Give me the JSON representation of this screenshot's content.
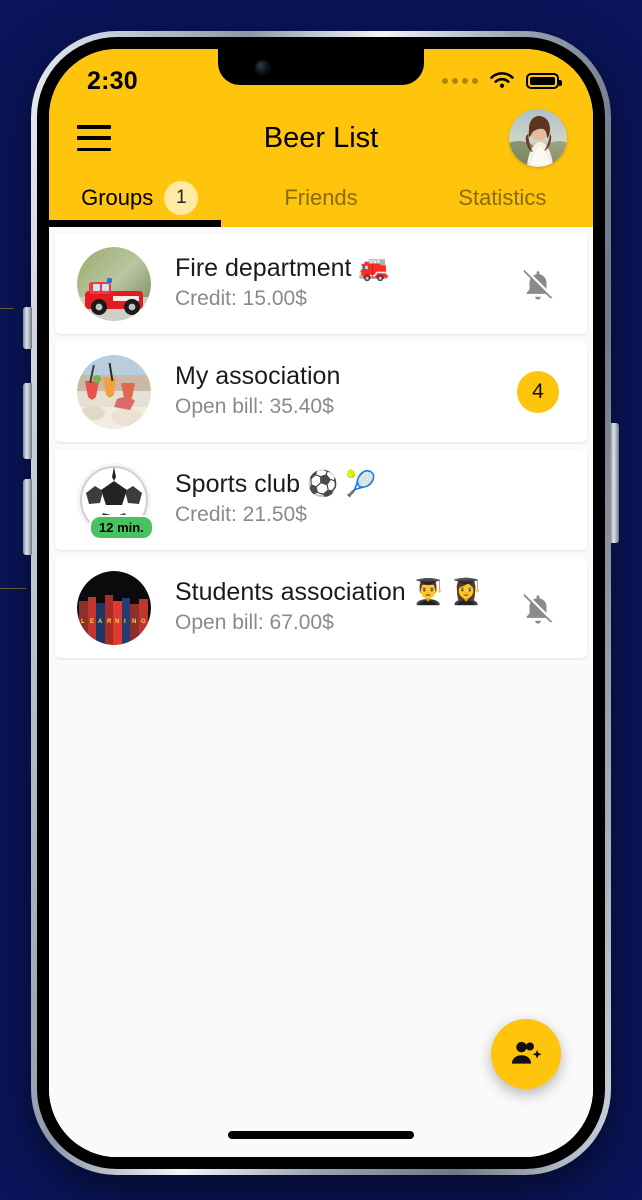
{
  "theme": {
    "backdrop_color": "#0a1559",
    "accent_color": "#FFC40C",
    "badge_soft_color": "#FFE9A3",
    "screen_bg": "#fafafa",
    "card_bg": "#ffffff",
    "muted_text": "#8a8a8a",
    "online_badge_color": "#48c261"
  },
  "status_bar": {
    "time": "2:30",
    "signal_icon": "signal-dots-icon",
    "wifi_icon": "wifi-icon",
    "battery_icon": "battery-full-icon"
  },
  "nav": {
    "menu_icon": "hamburger-menu-icon",
    "title": "Beer List",
    "avatar_icon": "user-avatar-photo"
  },
  "tabs": [
    {
      "label": "Groups",
      "badge": "1",
      "active": true
    },
    {
      "label": "Friends",
      "badge": null,
      "active": false
    },
    {
      "label": "Statistics",
      "badge": null,
      "active": false
    }
  ],
  "groups": [
    {
      "name": "Fire department 🚒",
      "subtitle": "Credit: 15.00$",
      "avatar_icon": "fire-truck-photo",
      "time_badge": null,
      "trailing_type": "bell-off",
      "trailing_value": null
    },
    {
      "name": "My association",
      "subtitle": "Open bill: 35.40$",
      "avatar_icon": "cheers-drinks-photo",
      "time_badge": null,
      "trailing_type": "count",
      "trailing_value": "4"
    },
    {
      "name": "Sports club ⚽ 🎾",
      "subtitle": "Credit: 21.50$",
      "avatar_icon": "soccer-ball-photo",
      "time_badge": "12 min.",
      "trailing_type": "none",
      "trailing_value": null
    },
    {
      "name": "Students association 👨‍🎓 👩‍🎓",
      "subtitle": "Open bill: 67.00$",
      "avatar_icon": "books-learning-photo",
      "time_badge": null,
      "trailing_type": "bell-off",
      "trailing_value": null
    }
  ],
  "fab": {
    "icon": "add-group-member-icon",
    "label": ""
  }
}
